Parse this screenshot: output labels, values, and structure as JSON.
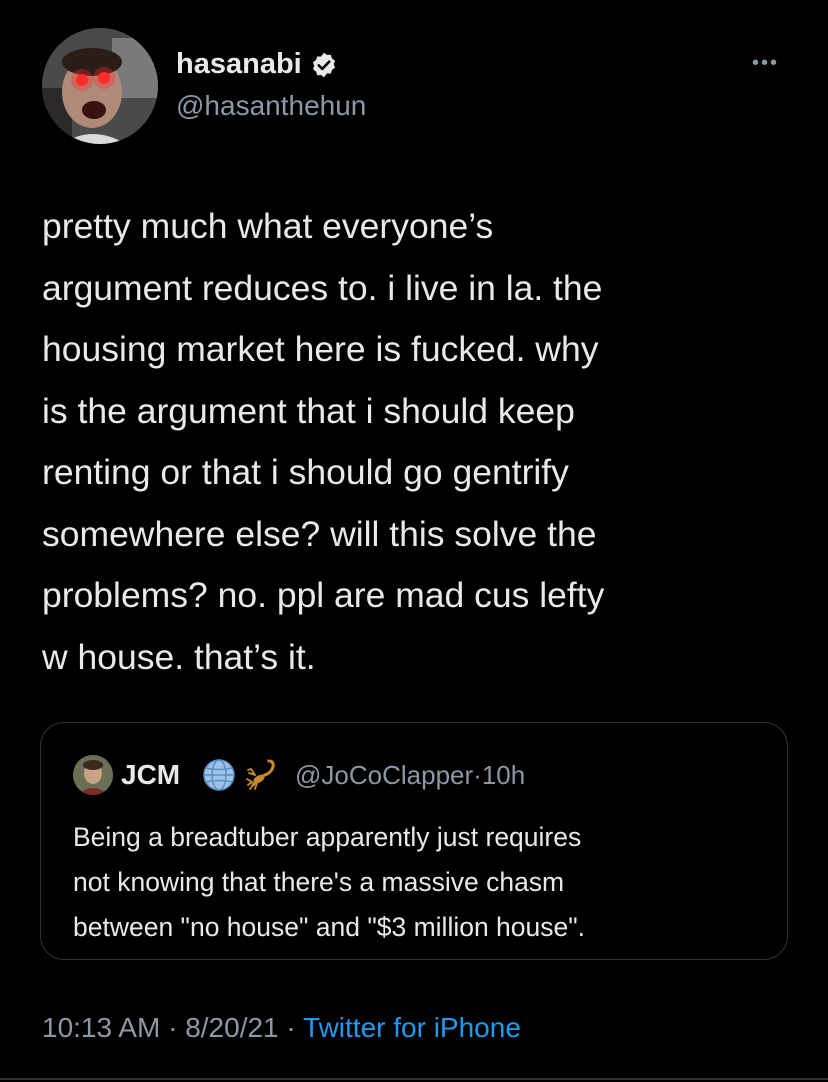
{
  "author": {
    "display_name": "hasanabi",
    "handle": "@hasanthehun",
    "verified": true,
    "avatar_icon": "profile-photo-glowing-eyes"
  },
  "more_icon": "more-horizontal-icon",
  "tweet": {
    "text": "pretty much what everyone’s\nargument reduces to. i live in la. the\nhousing market here is fucked. why\nis the argument that i should keep\nrenting or that i should go gentrify\nsomewhere else? will this solve the\nproblems? no. ppl are mad cus lefty\nw house. that’s it."
  },
  "quoted_tweet": {
    "display_name": "JCM",
    "badge_icons": [
      "globe-icon",
      "scorpion-icon"
    ],
    "handle": "@JoCoClapper",
    "time": "10h",
    "text": "Being a breadtuber apparently just requires\nnot knowing that there's a massive chasm\nbetween \"no house\" and \"$3 million house\"."
  },
  "meta": {
    "time": "10:13 AM",
    "date": "8/20/21",
    "source": "Twitter for iPhone",
    "separator": "·"
  },
  "colors": {
    "background": "#000000",
    "text": "#e7e9ea",
    "secondary": "#8b98a5",
    "link": "#1d9bf0",
    "border": "#2f3336"
  }
}
